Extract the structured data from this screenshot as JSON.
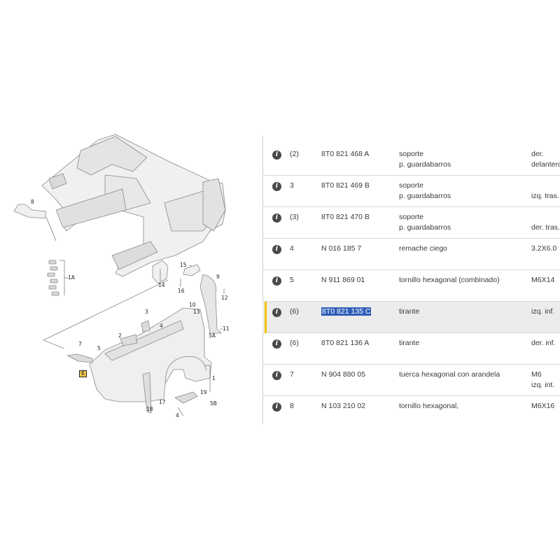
{
  "diagram": {
    "callouts": [
      {
        "id": "8-top",
        "text": "8"
      },
      {
        "id": "1A",
        "text": "1A"
      },
      {
        "id": "15",
        "text": "15"
      },
      {
        "id": "9",
        "text": "9"
      },
      {
        "id": "14",
        "text": "14"
      },
      {
        "id": "16",
        "text": "16"
      },
      {
        "id": "10",
        "text": "10"
      },
      {
        "id": "12",
        "text": "12"
      },
      {
        "id": "13",
        "text": "13"
      },
      {
        "id": "3",
        "text": "3"
      },
      {
        "id": "4",
        "text": "4"
      },
      {
        "id": "2",
        "text": "2"
      },
      {
        "id": "5",
        "text": "5"
      },
      {
        "id": "7",
        "text": "7"
      },
      {
        "id": "6",
        "text": "6"
      },
      {
        "id": "11",
        "text": "11"
      },
      {
        "id": "5A",
        "text": "5A"
      },
      {
        "id": "1",
        "text": "1"
      },
      {
        "id": "19",
        "text": "19"
      },
      {
        "id": "17",
        "text": "17"
      },
      {
        "id": "18",
        "text": "18"
      },
      {
        "id": "5B",
        "text": "5B"
      },
      {
        "id": "4-bottom",
        "text": "4"
      }
    ]
  },
  "parts": {
    "rows": [
      {
        "pos": "(2)",
        "part": "8T0 821 468 A",
        "desc": [
          "soporte",
          "p. guardabarros"
        ],
        "note": [
          "der.",
          "delantero"
        ],
        "selected": false
      },
      {
        "pos": "3",
        "part": "8T0 821 469 B",
        "desc": [
          "soporte",
          "p. guardabarros"
        ],
        "note": [
          "",
          "izq. tras."
        ],
        "selected": false
      },
      {
        "pos": "(3)",
        "part": "8T0 821 470 B",
        "desc": [
          "soporte",
          "p. guardabarros"
        ],
        "note": [
          "",
          "der. tras."
        ],
        "selected": false
      },
      {
        "pos": "4",
        "part": "N   016 185 7",
        "desc": [
          "remache ciego",
          ""
        ],
        "note": [
          "3.2X6.0",
          ""
        ],
        "selected": false
      },
      {
        "pos": "5",
        "part": "N   911 869 01",
        "desc": [
          "tornillo hexagonal (combinado)",
          ""
        ],
        "note": [
          "M6X14",
          ""
        ],
        "selected": false
      },
      {
        "pos": "(6)",
        "part": "8T0 821 135 C",
        "desc": [
          "tirante",
          ""
        ],
        "note": [
          "izq. inf.",
          ""
        ],
        "selected": true
      },
      {
        "pos": "(6)",
        "part": "8T0 821 136 A",
        "desc": [
          "tirante",
          ""
        ],
        "note": [
          "der. inf.",
          ""
        ],
        "selected": false
      },
      {
        "pos": "7",
        "part": "N   904 880 05",
        "desc": [
          "tuerca hexagonal con arandela",
          ""
        ],
        "note": [
          "M6",
          "izq. int."
        ],
        "selected": false
      },
      {
        "pos": "8",
        "part": "N   103 210 02",
        "desc": [
          "tornillo hexagonal,",
          ""
        ],
        "note": [
          "M6X16",
          ""
        ],
        "selected": false
      }
    ]
  },
  "colors": {
    "selection_bar": "#f2c200",
    "highlight": "#2f5db8",
    "info_icon": "#4a4a4a"
  }
}
